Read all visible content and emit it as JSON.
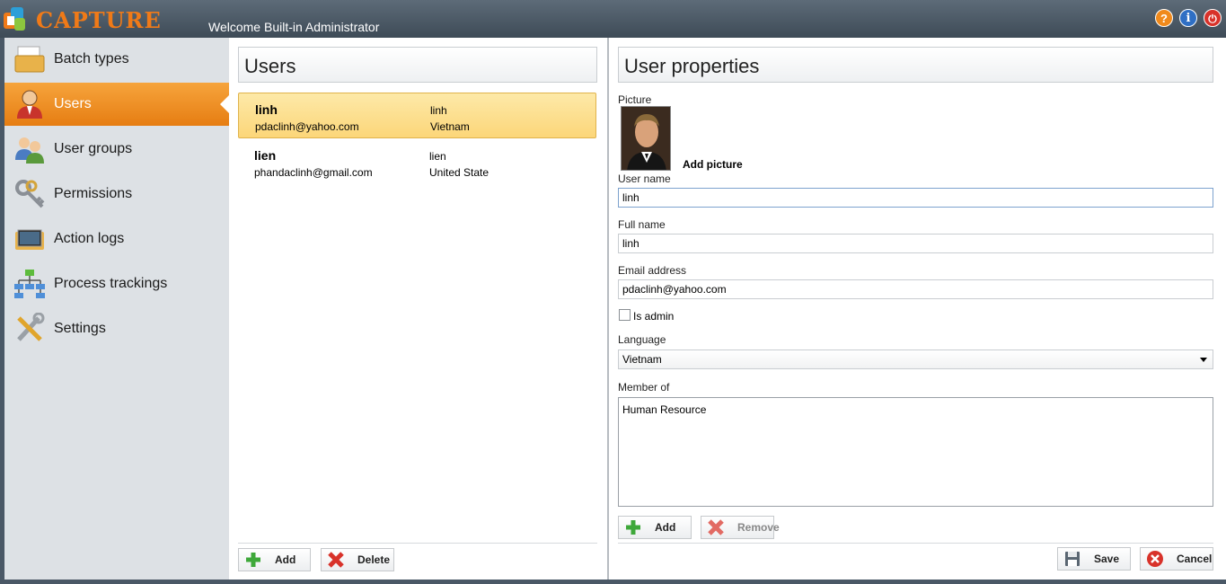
{
  "app": {
    "logo_text": "CAPTURE",
    "welcome": "Welcome Built-in Administrator"
  },
  "titlebar_icons": [
    {
      "name": "help-icon",
      "glyph": "?",
      "color": "#f08a1c"
    },
    {
      "name": "info-icon",
      "glyph": "i",
      "color": "#2f6fc4"
    },
    {
      "name": "power-icon",
      "glyph": "⏻",
      "color": "#d8322a"
    }
  ],
  "sidebar": {
    "items": [
      {
        "label": "Batch types",
        "icon": "batch-types-icon"
      },
      {
        "label": "Users",
        "icon": "users-icon",
        "active": true
      },
      {
        "label": "User groups",
        "icon": "user-groups-icon"
      },
      {
        "label": "Permissions",
        "icon": "keys-icon"
      },
      {
        "label": "Action logs",
        "icon": "monitor-folder-icon"
      },
      {
        "label": "Process trackings",
        "icon": "flowchart-icon"
      },
      {
        "label": "Settings",
        "icon": "tools-icon"
      }
    ]
  },
  "users_panel": {
    "title": "Users",
    "users": [
      {
        "name": "linh",
        "email": "pdaclinh@yahoo.com",
        "username": "linh",
        "country": "Vietnam",
        "selected": true
      },
      {
        "name": "lien",
        "email": "phandaclinh@gmail.com",
        "username": "lien",
        "country": "United State",
        "selected": false
      }
    ],
    "add_label": "Add",
    "delete_label": "Delete"
  },
  "properties": {
    "title": "User properties",
    "picture_label": "Picture",
    "add_picture": "Add picture",
    "username_label": "User name",
    "username": "linh",
    "fullname_label": "Full name",
    "fullname": "linh",
    "email_label": "Email address",
    "email": "pdaclinh@yahoo.com",
    "is_admin_label": "Is admin",
    "is_admin": false,
    "language_label": "Language",
    "language": "Vietnam",
    "member_of_label": "Member of",
    "member_of": [
      "Human Resource"
    ],
    "add_label": "Add",
    "remove_label": "Remove",
    "save_label": "Save",
    "cancel_label": "Cancel"
  },
  "colors": {
    "accent": "#f08a1c",
    "selection": "#fcd679",
    "sidebar_bg": "#dde1e5"
  }
}
